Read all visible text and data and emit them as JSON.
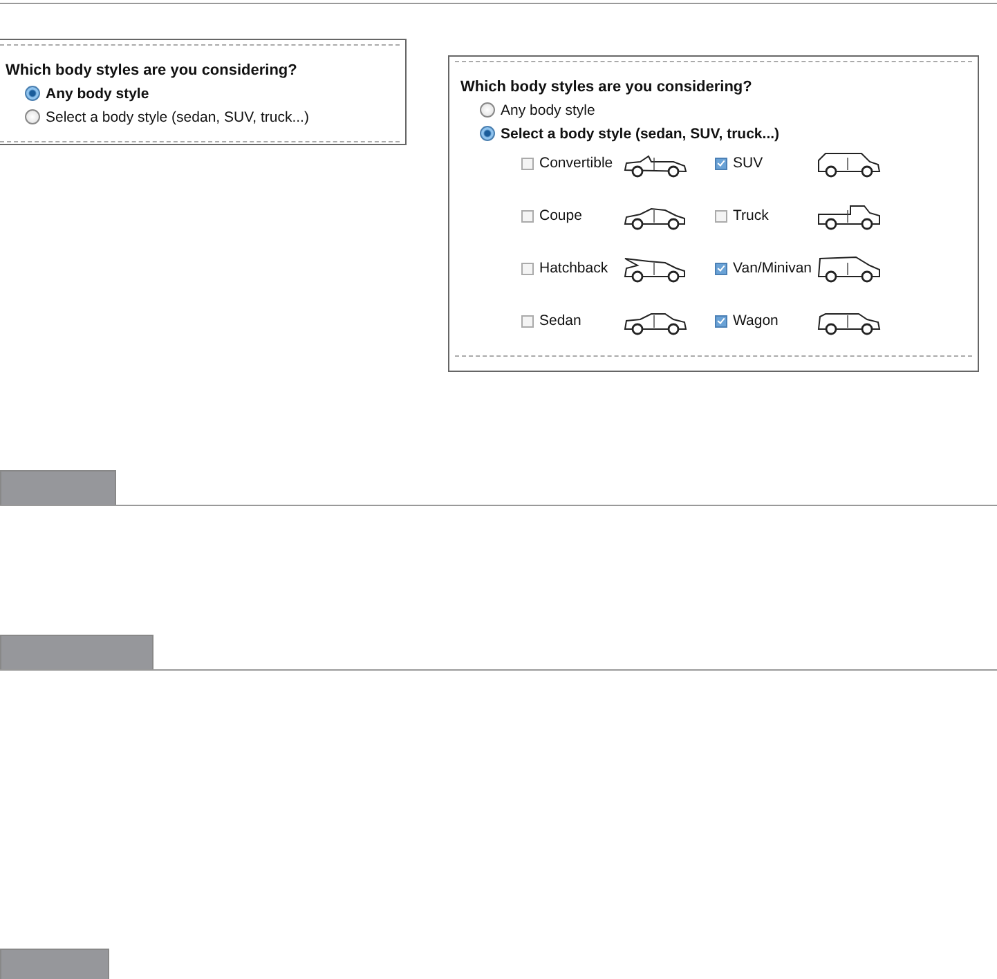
{
  "panels": [
    {
      "question": "Which body styles are you considering?",
      "options": [
        {
          "label": "Any body style",
          "selected": true
        },
        {
          "label": "Select a body style (sedan, SUV, truck...)",
          "selected": false
        }
      ]
    },
    {
      "question": "Which body styles are you considering?",
      "options": [
        {
          "label": "Any body style",
          "selected": false
        },
        {
          "label": "Select a body style (sedan, SUV, truck...)",
          "selected": true
        }
      ],
      "body_styles": [
        {
          "label": "Convertible",
          "checked": false,
          "kind": "convertible"
        },
        {
          "label": "SUV",
          "checked": true,
          "kind": "suv"
        },
        {
          "label": "Coupe",
          "checked": false,
          "kind": "coupe"
        },
        {
          "label": "Truck",
          "checked": false,
          "kind": "truck"
        },
        {
          "label": "Hatchback",
          "checked": false,
          "kind": "hatchback"
        },
        {
          "label": "Van/Minivan",
          "checked": true,
          "kind": "van"
        },
        {
          "label": "Sedan",
          "checked": false,
          "kind": "sedan"
        },
        {
          "label": "Wagon",
          "checked": true,
          "kind": "wagon"
        }
      ]
    }
  ]
}
